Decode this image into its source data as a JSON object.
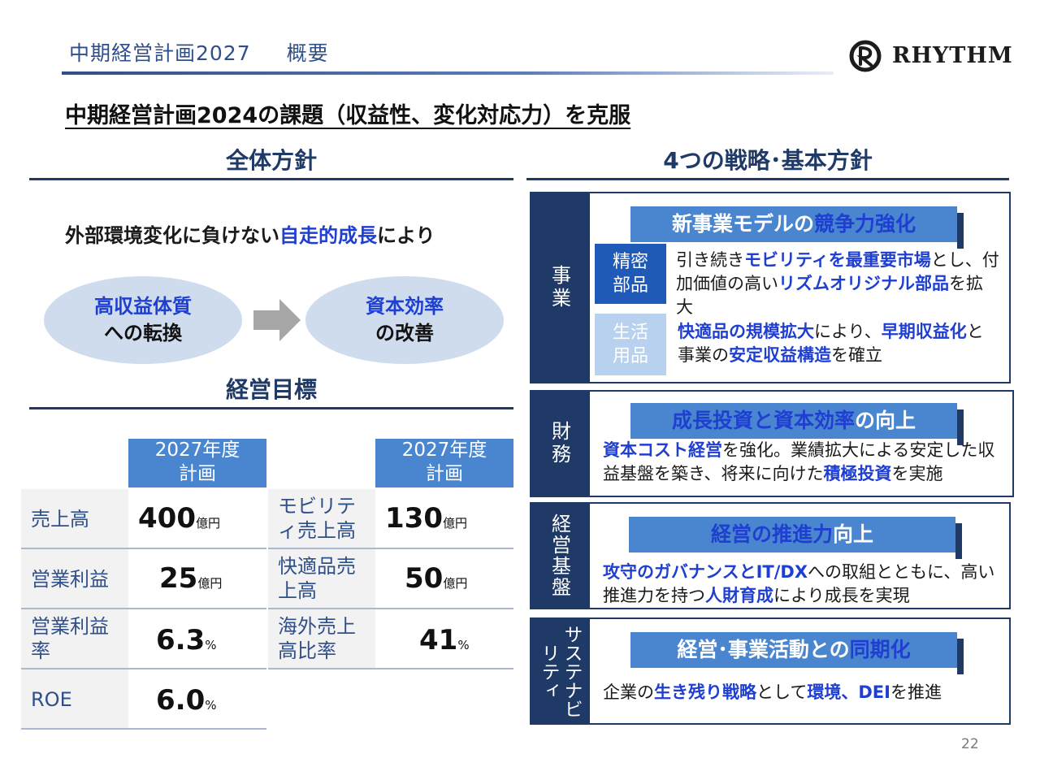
{
  "header": {
    "title": "中期経営計画2027",
    "subtitle": "概要",
    "logo_text": "RHYTHM"
  },
  "headline": "中期経営計画2024の課題（収益性、変化対応力）を克服",
  "left": {
    "policy_heading": "全体方針",
    "policy_line": {
      "pre": "外部環境変化に負けない",
      "highlight": "自走的成長",
      "post": "により"
    },
    "goal1": {
      "line1": "高収益体質",
      "line2": "への転換"
    },
    "goal2": {
      "line1": "資本効率",
      "line2": "の改善"
    },
    "targets_heading": "経営目標",
    "year_header": {
      "line1": "2027年度",
      "line2": "計画"
    },
    "targets_left": [
      {
        "label": "売上高",
        "value": "400",
        "unit": "億円"
      },
      {
        "label": "営業利益",
        "value": "25",
        "unit": "億円"
      },
      {
        "label": "営業利益率",
        "value": "6.3",
        "unit": "%"
      },
      {
        "label": "ROE",
        "value": "6.0",
        "unit": "%"
      }
    ],
    "targets_right": [
      {
        "label": "モビリティ売上高",
        "value": "130",
        "unit": "億円"
      },
      {
        "label": "快適品売上高",
        "value": "50",
        "unit": "億円"
      },
      {
        "label": "海外売上高比率",
        "value": "41",
        "unit": "%"
      }
    ]
  },
  "right": {
    "strategy_heading": "4つの戦略･基本方針",
    "business": {
      "side": "事業",
      "banner": {
        "pre": "新事業モデルの",
        "highlight": "競争力強化",
        "post": ""
      },
      "precision": {
        "tag": "精密部品",
        "desc": [
          {
            "t": "引き続き",
            "h": false
          },
          {
            "t": "モビリティを最重要市場",
            "h": true
          },
          {
            "t": "とし、付加価値の高い",
            "h": false
          },
          {
            "t": "リズムオリジナル部品",
            "h": true
          },
          {
            "t": "を拡大",
            "h": false
          }
        ]
      },
      "living": {
        "tag": "生活用品",
        "desc": [
          {
            "t": "快適品の規模拡大",
            "h": true
          },
          {
            "t": "により、",
            "h": false
          },
          {
            "t": "早期収益化",
            "h": true
          },
          {
            "t": "と事業の",
            "h": false
          },
          {
            "t": "安定収益構造",
            "h": true
          },
          {
            "t": "を確立",
            "h": false
          }
        ]
      }
    },
    "finance": {
      "side": "財務",
      "banner": {
        "pre": "",
        "highlight": "成長投資と資本効率",
        "post": "の向上"
      },
      "desc": [
        {
          "t": "資本コスト経営",
          "h": true
        },
        {
          "t": "を強化。業績拡大による安定した収益基盤を築き、将来に向けた",
          "h": false
        },
        {
          "t": "積極投資",
          "h": true
        },
        {
          "t": "を実施",
          "h": false
        }
      ]
    },
    "management": {
      "side": "経営基盤",
      "banner": {
        "pre": "",
        "highlight": "経営の推進力",
        "post": "向上"
      },
      "desc": [
        {
          "t": "攻守のガバナンスとIT/DX",
          "h": true
        },
        {
          "t": "への取組とともに、高い推進力を持つ",
          "h": false
        },
        {
          "t": "人財育成",
          "h": true
        },
        {
          "t": "により成長を実現",
          "h": false
        }
      ]
    },
    "sustainability": {
      "side": "サステナビリティ",
      "banner": {
        "pre": "経営･事業活動との",
        "highlight": "同期化",
        "post": ""
      },
      "desc": [
        {
          "t": "企業の",
          "h": false
        },
        {
          "t": "生き残り戦略",
          "h": true
        },
        {
          "t": "として",
          "h": false
        },
        {
          "t": "環境、DEI",
          "h": true
        },
        {
          "t": "を推進",
          "h": false
        }
      ]
    }
  },
  "page_number": "22",
  "colors": {
    "navy": "#1f3a66",
    "blue": "#4a86cf",
    "highlight": "#1f3fd0",
    "ellipse": "#cfdcee"
  }
}
